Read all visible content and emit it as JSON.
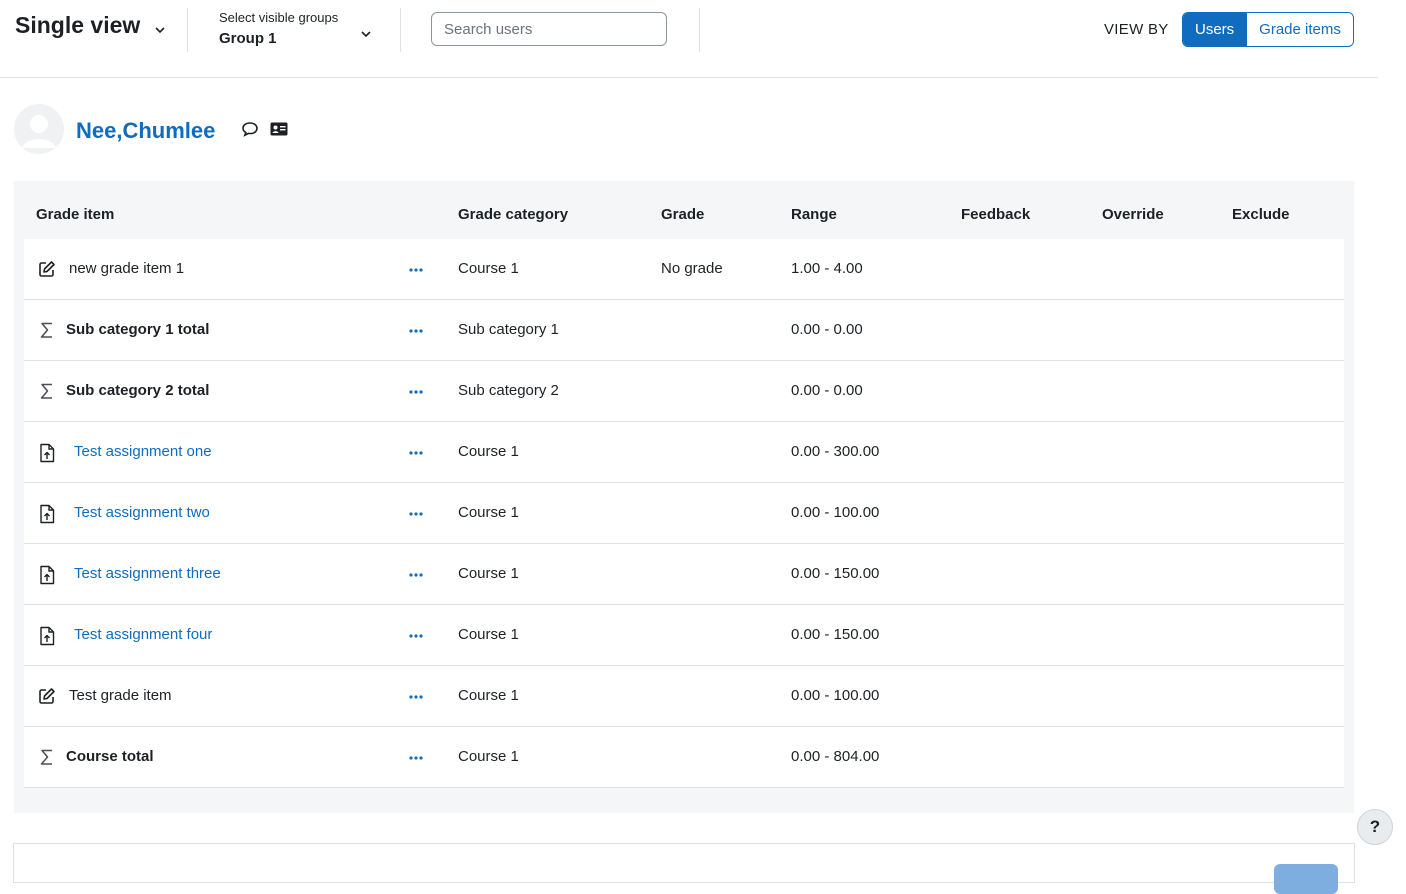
{
  "header": {
    "view_title": "Single view",
    "group_select_label": "Select visible groups",
    "group_select_value": "Group 1",
    "search_placeholder": "Search users",
    "view_by_label": "VIEW BY",
    "view_by_options": [
      {
        "label": "Users",
        "active": true
      },
      {
        "label": "Grade items",
        "active": false
      }
    ]
  },
  "user": {
    "name": "Nee,Chumlee",
    "icons": [
      "message-icon",
      "profile-card-icon"
    ]
  },
  "table": {
    "columns": [
      "Grade item",
      "Grade category",
      "Grade",
      "Range",
      "Feedback",
      "Override",
      "Exclude"
    ],
    "rows": [
      {
        "icon": "edit-icon",
        "name": "new grade item 1",
        "style": "plain",
        "category": "Course 1",
        "grade": "No grade",
        "range": "1.00 - 4.00"
      },
      {
        "icon": "sigma-icon",
        "name": "Sub category 1 total",
        "style": "bold",
        "category": "Sub category 1",
        "grade": "",
        "range": "0.00 - 0.00"
      },
      {
        "icon": "sigma-icon",
        "name": "Sub category 2 total",
        "style": "bold",
        "category": "Sub category 2",
        "grade": "",
        "range": "0.00 - 0.00"
      },
      {
        "icon": "assignment-icon",
        "name": "Test assignment one",
        "style": "link",
        "category": "Course 1",
        "grade": "",
        "range": "0.00 - 300.00"
      },
      {
        "icon": "assignment-icon",
        "name": "Test assignment two",
        "style": "link",
        "category": "Course 1",
        "grade": "",
        "range": "0.00 - 100.00"
      },
      {
        "icon": "assignment-icon",
        "name": "Test assignment three",
        "style": "link",
        "category": "Course 1",
        "grade": "",
        "range": "0.00 - 150.00"
      },
      {
        "icon": "assignment-icon",
        "name": "Test assignment four",
        "style": "link",
        "category": "Course 1",
        "grade": "",
        "range": "0.00 - 150.00"
      },
      {
        "icon": "edit-icon",
        "name": "Test grade item",
        "style": "plain",
        "category": "Course 1",
        "grade": "",
        "range": "0.00 - 100.00"
      },
      {
        "icon": "sigma-icon",
        "name": "Course total",
        "style": "bold",
        "category": "Course 1",
        "grade": "",
        "range": "0.00 - 804.00"
      }
    ]
  },
  "help": {
    "label": "?"
  },
  "colors": {
    "accent": "#0f6cbf",
    "text": "#1d2125",
    "panel_bg": "#f5f6f7",
    "border": "#dee2e6"
  }
}
